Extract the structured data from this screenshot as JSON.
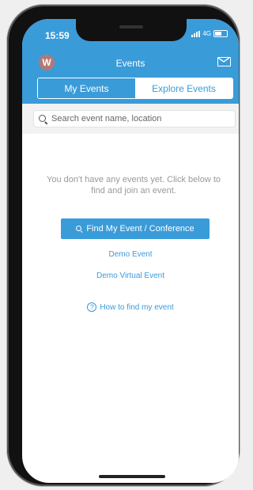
{
  "status_bar": {
    "time": "15:59",
    "network": "4G"
  },
  "header": {
    "avatar_letter": "W",
    "title": "Events"
  },
  "tabs": [
    {
      "label": "My Events",
      "active": true
    },
    {
      "label": "Explore Events",
      "active": false
    }
  ],
  "search": {
    "placeholder": "Search event name, location"
  },
  "empty_state": {
    "message": "You don't have any events yet. Click below to find and join an event."
  },
  "actions": {
    "find_button": "Find My Event / Conference",
    "demo_event": "Demo Event",
    "demo_virtual_event": "Demo Virtual Event",
    "help_link": "How to find my event"
  },
  "colors": {
    "accent": "#3a9bd9",
    "avatar": "#b07a78"
  }
}
